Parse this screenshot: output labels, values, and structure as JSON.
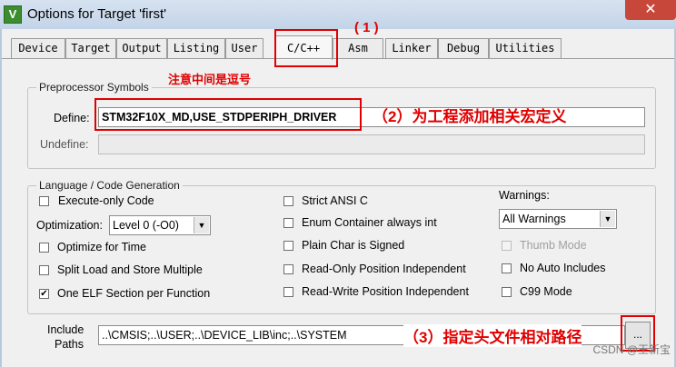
{
  "window": {
    "title": "Options for Target 'first'",
    "app_icon_glyph": "V",
    "close_glyph": "✕"
  },
  "tabs": [
    "Device",
    "Target",
    "Output",
    "Listing",
    "User",
    "C/C++",
    "Asm",
    "Linker",
    "Debug",
    "Utilities"
  ],
  "active_tab": "C/C++",
  "annotations": {
    "a1": "( 1 )",
    "note": "注意中间是逗号",
    "a2": "（2）为工程添加相关宏定义",
    "a3": "（3）指定头文件相对路径",
    "color": "#e00000"
  },
  "preprocessor": {
    "title": "Preprocessor Symbols",
    "define_label": "Define:",
    "define_value": "STM32F10X_MD,USE_STDPERIPH_DRIVER",
    "undefine_label": "Undefine:",
    "undefine_value": ""
  },
  "language": {
    "title": "Language / Code Generation",
    "execute_only": {
      "label": "Execute-only Code",
      "checked": false
    },
    "optimization_label": "Optimization:",
    "optimization_value": "Level 0 (-O0)",
    "optimize_time": {
      "label": "Optimize for Time",
      "checked": false
    },
    "split_load": {
      "label": "Split Load and Store Multiple",
      "checked": false
    },
    "one_elf": {
      "label": "One ELF Section per Function",
      "checked": true
    },
    "strict_ansi": {
      "label": "Strict ANSI C",
      "checked": false
    },
    "enum_container": {
      "label": "Enum Container always int",
      "checked": false
    },
    "plain_char": {
      "label": "Plain Char is Signed",
      "checked": false
    },
    "ro_pi": {
      "label": "Read-Only Position Independent",
      "checked": false
    },
    "rw_pi": {
      "label": "Read-Write Position Independent",
      "checked": false
    },
    "warnings_label": "Warnings:",
    "warnings_value": "All Warnings",
    "thumb_mode": {
      "label": "Thumb Mode",
      "checked": false,
      "disabled": true
    },
    "no_auto_includes": {
      "label": "No Auto Includes",
      "checked": false
    },
    "c99_mode": {
      "label": "C99 Mode",
      "checked": false
    }
  },
  "include": {
    "label_line1": "Include",
    "label_line2": "Paths",
    "value": "..\\CMSIS;..\\USER;..\\DEVICE_LIB\\inc;..\\SYSTEM",
    "browse_label": "..."
  },
  "watermark": "CSDN @王新宝",
  "checkmark_glyph": "✔",
  "dropdown_glyph": "▼"
}
